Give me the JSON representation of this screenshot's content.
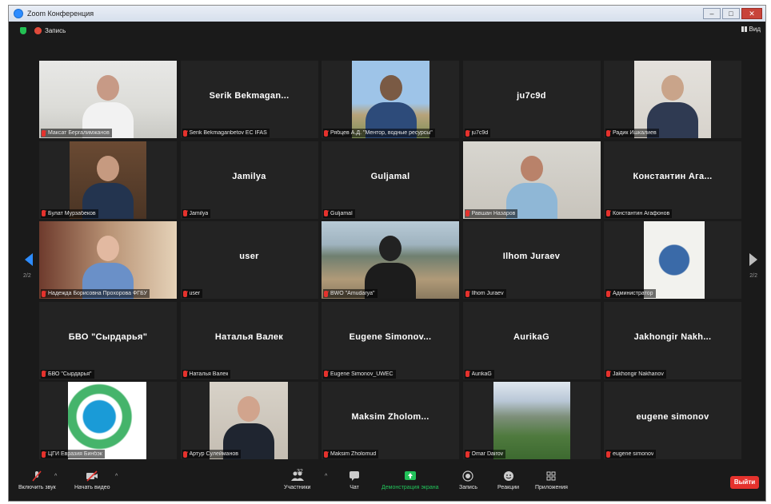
{
  "window": {
    "title": "Zoom Конференция"
  },
  "topbar": {
    "recording_label": "Запись",
    "view_label": "Вид"
  },
  "pagination": {
    "left_page": "2/2",
    "right_page": "2/2"
  },
  "tiles": [
    {
      "display": "",
      "label": "Максат Бергалимжанов"
    },
    {
      "display": "Serik Bekmagan...",
      "label": "Serik Bekmaganbetov EC IFAS"
    },
    {
      "display": "",
      "label": "Рябцев А.Д. \"Ментор, водные ресурсы\""
    },
    {
      "display": "ju7c9d",
      "label": "ju7c9d"
    },
    {
      "display": "",
      "label": "Радик Ишкалиев"
    },
    {
      "display": "",
      "label": "Булат Мурзабеков"
    },
    {
      "display": "Jamilya",
      "label": "Jamilya"
    },
    {
      "display": "Guljamal",
      "label": "Guljamal"
    },
    {
      "display": "",
      "label": "Равшан Назаров"
    },
    {
      "display": "Константин Ага...",
      "label": "Константин Агафонов"
    },
    {
      "display": "",
      "label": "Надежда Борисовна Прохорова ФГБУ"
    },
    {
      "display": "user",
      "label": "user"
    },
    {
      "display": "",
      "label": "BWO \"Amudarya\""
    },
    {
      "display": "Ilhom Juraev",
      "label": "Ilhom Juraev"
    },
    {
      "display": "",
      "label": "Администратор"
    },
    {
      "display": "БВО \"Сырдарья\"",
      "label": "БВО \"Сырдарья\""
    },
    {
      "display": "Наталья Валек",
      "label": "Наталья Валек"
    },
    {
      "display": "Eugene Simonov...",
      "label": "Eugene Simonov_UWEC"
    },
    {
      "display": "AurikaG",
      "label": "AurikaG"
    },
    {
      "display": "Jakhongir Nakh...",
      "label": "Jakhongir Nakhanov"
    },
    {
      "display": "",
      "label": "ЦГИ Евразия Бинбэк"
    },
    {
      "display": "",
      "label": "Артур Сулейманов"
    },
    {
      "display": "Maksim Zholom...",
      "label": "Maksim Zholomud"
    },
    {
      "display": "",
      "label": "Omar Dairov"
    },
    {
      "display": "eugene simonov",
      "label": "eugene simonov"
    }
  ],
  "toolbar": {
    "audio": "Включить звук",
    "video": "Начать видео",
    "participants": "Участники",
    "participants_count": "32",
    "chat": "Чат",
    "share": "Демонстрация экрана",
    "record": "Запись",
    "reactions": "Реакции",
    "apps": "Приложения",
    "leave": "Выйти"
  },
  "colors": {
    "accent": "#2d8cff",
    "leave": "#e5322d",
    "share": "#22c25a"
  }
}
